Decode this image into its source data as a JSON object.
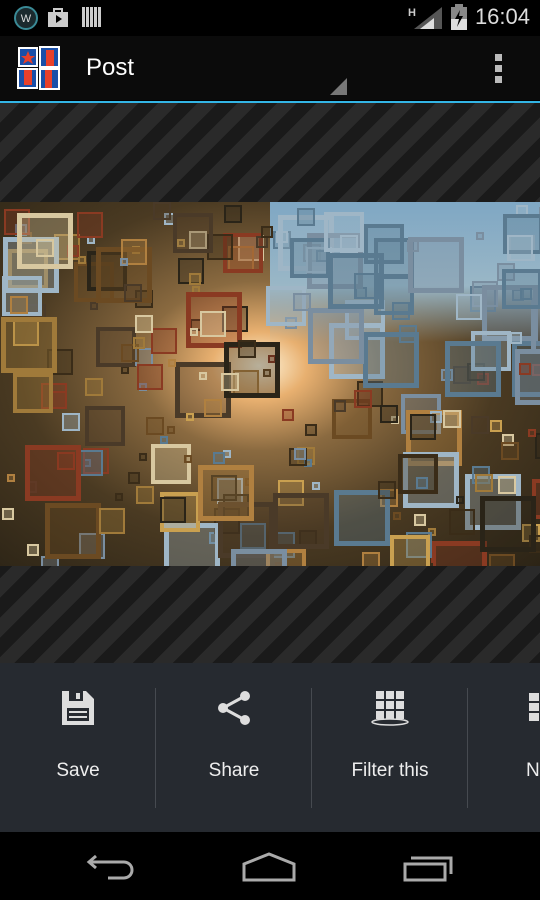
{
  "status_bar": {
    "time": "16:04",
    "icons": [
      "wordpress-icon",
      "play-store-icon",
      "barcode-icon",
      "h-signal-icon",
      "battery-charging-icon"
    ]
  },
  "action_bar": {
    "title": "Post",
    "app_icon": "app-logo-icon",
    "menu_icon": "overflow-menu-icon"
  },
  "actions": [
    {
      "label": "Save",
      "icon": "save-icon"
    },
    {
      "label": "Share",
      "icon": "share-icon"
    },
    {
      "label": "Filter this",
      "icon": "filter-grid-icon"
    },
    {
      "label": "N",
      "icon": "grid-icon"
    }
  ],
  "nav_bar": {
    "icons": [
      "back-icon",
      "home-icon",
      "recents-icon"
    ]
  },
  "colors": {
    "accent": "#33b5e5",
    "panel": "#262a30"
  }
}
